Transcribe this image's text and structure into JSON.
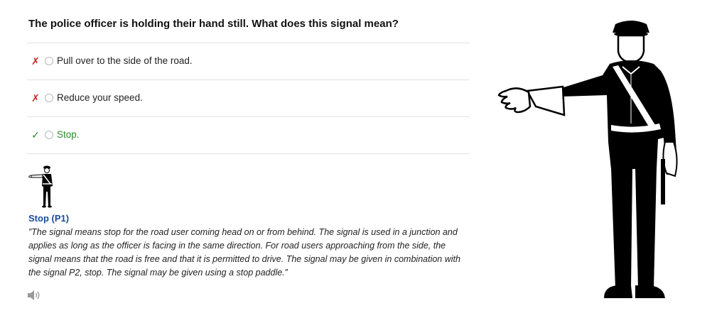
{
  "question": {
    "text": "The police officer is holding their hand still. What does this signal mean?"
  },
  "options": [
    {
      "label": "Pull over to the side of the road.",
      "status": "wrong",
      "mark": "✗"
    },
    {
      "label": "Reduce your speed.",
      "status": "wrong",
      "mark": "✗"
    },
    {
      "label": "Stop.",
      "status": "correct",
      "mark": "✓"
    }
  ],
  "explanation": {
    "title": "Stop (P1)",
    "text": "”The signal means stop for the road user coming head on or from behind. The signal is used in a junction and applies as long as the officer is facing in the same direction. For road users approaching from the side, the signal means that the road is free and that it is permitted to drive. The signal may be given in combination with the signal P2, stop. The signal may be given using a stop paddle.”"
  },
  "icons": {
    "wrong": "cross-icon",
    "correct": "checkmark-icon",
    "audio": "speaker-icon",
    "figure": "police-officer-illustration"
  },
  "colors": {
    "wrong": "#cc2222",
    "correct": "#2a8a2a",
    "title": "#1a4a9c",
    "divider": "#e2e2e2"
  }
}
